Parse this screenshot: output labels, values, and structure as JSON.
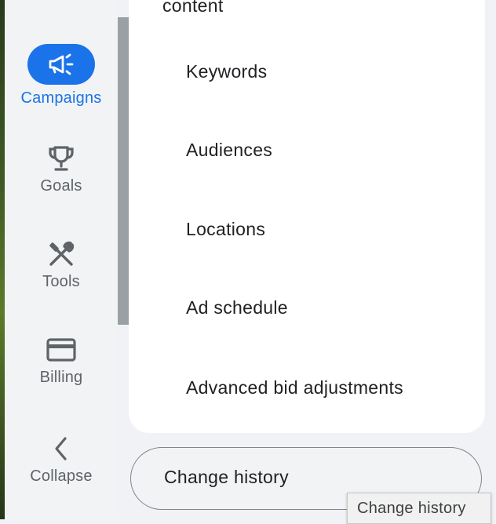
{
  "colors": {
    "accent": "#1a73e8",
    "nav_text": "#5f6368",
    "body_text": "#202124"
  },
  "nav": {
    "items": [
      {
        "label": "Campaigns",
        "icon": "megaphone-icon",
        "active": true
      },
      {
        "label": "Goals",
        "icon": "trophy-icon",
        "active": false
      },
      {
        "label": "Tools",
        "icon": "tools-icon",
        "active": false
      },
      {
        "label": "Billing",
        "icon": "credit-card-icon",
        "active": false
      },
      {
        "label": "Collapse",
        "icon": "chevron-left-icon",
        "active": false
      }
    ]
  },
  "panel": {
    "partial_heading": "content",
    "items": [
      {
        "label": "Keywords"
      },
      {
        "label": "Audiences"
      },
      {
        "label": "Locations"
      },
      {
        "label": "Ad schedule"
      },
      {
        "label": "Advanced bid adjustments"
      }
    ]
  },
  "change_history": {
    "label": "Change history",
    "tooltip": "Change history"
  }
}
